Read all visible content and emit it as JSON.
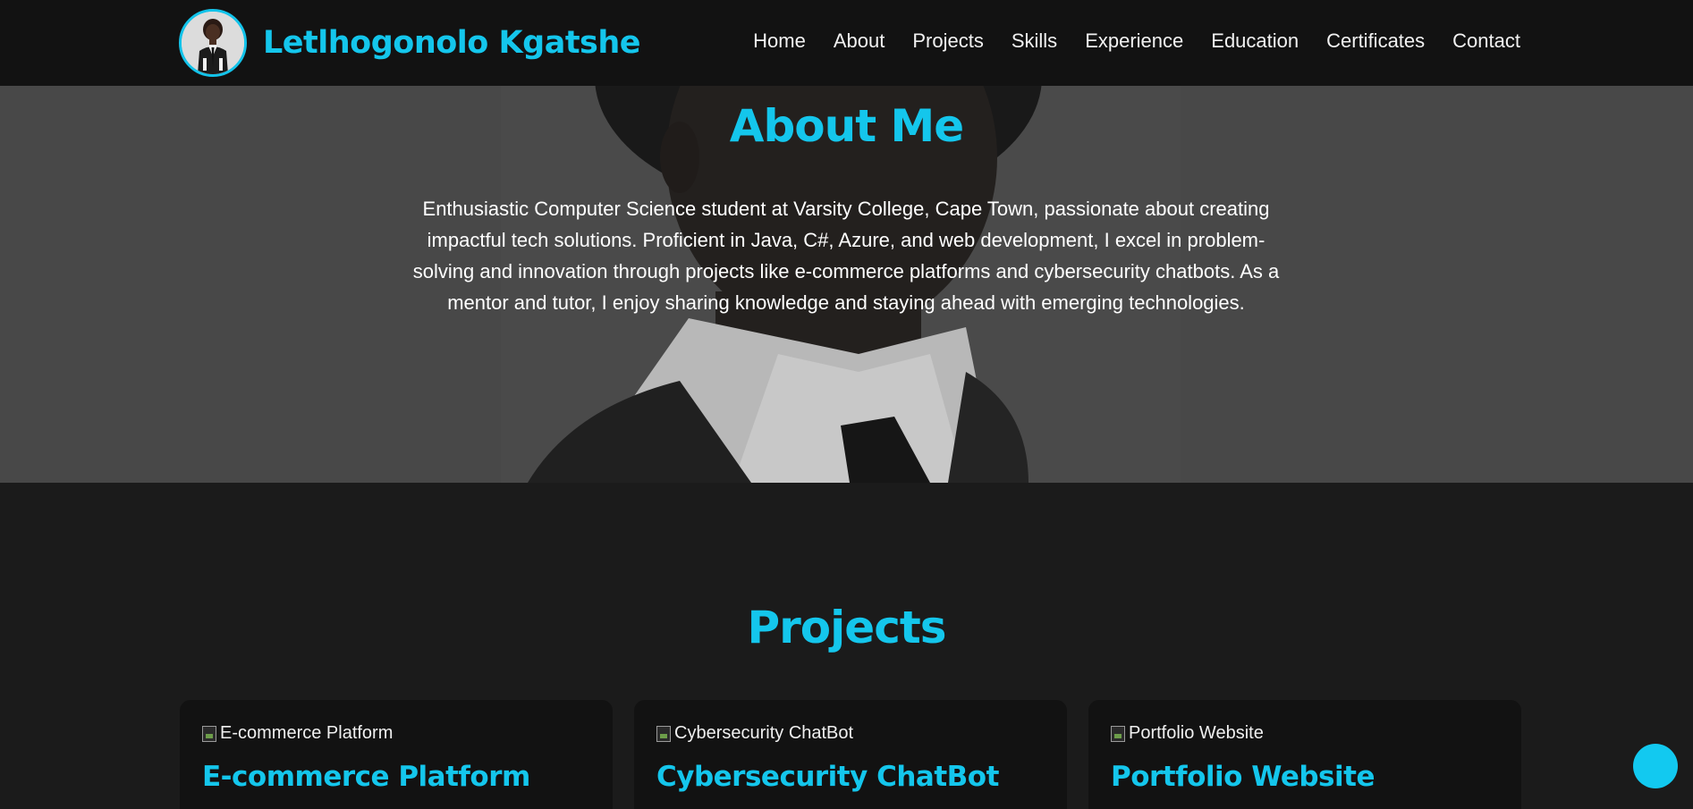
{
  "colors": {
    "accent": "#14c6ec",
    "nav_bg": "#121212",
    "page_bg": "#1b1b1b",
    "card_bg": "#121212"
  },
  "brand": {
    "name": "Letlhogonolo Kgatshe",
    "avatar_icon": "profile-photo"
  },
  "nav": {
    "items": [
      {
        "label": "Home"
      },
      {
        "label": "About"
      },
      {
        "label": "Projects"
      },
      {
        "label": "Skills"
      },
      {
        "label": "Experience"
      },
      {
        "label": "Education"
      },
      {
        "label": "Certificates"
      },
      {
        "label": "Contact"
      }
    ]
  },
  "about": {
    "title": "About Me",
    "text": "Enthusiastic Computer Science student at Varsity College, Cape Town, passionate about creating impactful tech solutions. Proficient in Java, C#, Azure, and web development, I excel in problem-solving and innovation through projects like e-commerce platforms and cybersecurity chatbots. As a mentor and tutor, I enjoy sharing knowledge and staying ahead with emerging technologies."
  },
  "projects": {
    "title": "Projects",
    "cards": [
      {
        "img_alt": "E-commerce Platform",
        "title": "E-commerce Platform"
      },
      {
        "img_alt": "Cybersecurity ChatBot",
        "title": "Cybersecurity ChatBot"
      },
      {
        "img_alt": "Portfolio Website",
        "title": "Portfolio Website"
      }
    ]
  },
  "fab": {
    "icon": "circle-button"
  }
}
